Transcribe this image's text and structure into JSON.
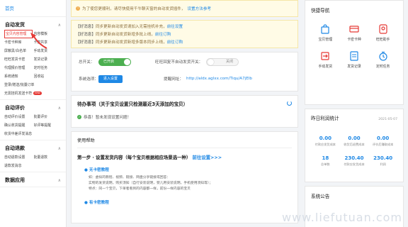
{
  "sidebar": {
    "home": "首页",
    "groups": [
      {
        "title": "自动发货",
        "items": [
          {
            "label": "宝贝内容管理",
            "active": true
          },
          {
            "label": "内容模板"
          },
          {
            "label": "卡密卡种库"
          },
          {
            "label": "卡密共享"
          },
          {
            "label": "屏蔽黑/白名单"
          },
          {
            "label": "手动发货"
          },
          {
            "label": "旺旺发货卡密"
          },
          {
            "label": "发货记录"
          },
          {
            "label": "代理报价管理"
          },
          {
            "label": "定时任务"
          },
          {
            "label": "系统通知"
          },
          {
            "label": "回收站"
          },
          {
            "label": "登录/赠送/批量订单",
            "full": true
          },
          {
            "label": "无需挂机发送卡符",
            "full": true,
            "badge": "new"
          }
        ]
      },
      {
        "title": "自动评价",
        "items": [
          {
            "label": "自动评价设置"
          },
          {
            "label": "批量评价"
          },
          {
            "label": "确认收货提醒"
          },
          {
            "label": "好评等提醒"
          },
          {
            "label": "收货中差评发消息",
            "full": true
          }
        ]
      },
      {
        "title": "自动退款",
        "items": [
          {
            "label": "自动退款设置"
          },
          {
            "label": "批量退款"
          },
          {
            "label": "退款发消息",
            "full": true
          }
        ]
      },
      {
        "title": "数据应用",
        "items": []
      }
    ]
  },
  "main": {
    "notice1": {
      "text": "为了使您更顺利，请尽快使用千牛聊天窗的自动发货插件，",
      "link": "设置方法参考"
    },
    "notice2": [
      {
        "tag": "【好消息】",
        "text": "同步更新自动发货请加入无需挂机补充，",
        "link": "前往设置"
      },
      {
        "tag": "【好消息】",
        "text": "同步更新自动发货新增多批上线，",
        "link": "前往订购"
      },
      {
        "tag": "【好消息】",
        "text": "同步更新自动发货新增多版本同步上线，",
        "link": "前往订购"
      }
    ],
    "switches": {
      "total_label": "总开关：",
      "total_value": "已开启",
      "retry_label": "旺旺回复不自动发货开关：",
      "retry_value": "关闭",
      "status_label": "系统选项：",
      "status_button": "进入设置",
      "reminder_label": "提醒网址：",
      "reminder_link": "http://aldx.aglxx.com/Tiqu/A7jElb"
    },
    "todo": {
      "title": "待办事项（关于宝贝设置只检测最近3天添加的宝贝）",
      "ok_text": "恭喜！暂未发现设置问题！"
    },
    "help": {
      "title": "使用帮助",
      "step1": "第一步 · 设置发货内容（每个宝贝根据相应场景选一种）",
      "step1_link": "前往设置>>>",
      "sub1": "无卡密教程",
      "desc": [
        "如：虚拟的教程、视频、链接、网盘分享链接或回答：",
        "实物的发货说明，购买须知（自行安装说明，婴儿用安装说明，手机使用须知等）；",
        "特点：同一个宝贝，下单者看到的内容都一样，前份一样内容的宝贝"
      ],
      "sub2": "有卡密教程"
    }
  },
  "right": {
    "nav": {
      "title": "快捷导航",
      "items": [
        {
          "label": "宝贝管理",
          "icon": "shopping-bag-icon"
        },
        {
          "label": "卡密卡种",
          "icon": "card-icon"
        },
        {
          "label": "旺旺助手",
          "icon": "assistant-icon"
        },
        {
          "label": "手动发货",
          "icon": "send-icon"
        },
        {
          "label": "发货记录",
          "icon": "record-icon"
        },
        {
          "label": "定时任务",
          "icon": "timer-icon"
        }
      ]
    },
    "stats": {
      "title": "昨日利润统计",
      "date": "2021-05-07",
      "items": [
        {
          "value": "0.00",
          "label": "付款应发货成本"
        },
        {
          "value": "0.00",
          "label": "收货后退费成本"
        },
        {
          "value": "0.00",
          "label": "评价后赚取成本"
        },
        {
          "value": "18",
          "label": "总单数"
        },
        {
          "value": "230.40",
          "label": "付款应发货成本"
        },
        {
          "value": "230.40",
          "label": "利润"
        }
      ]
    },
    "announce": {
      "title": "系统公告"
    }
  },
  "watermark": "www.liefutuan.com",
  "colors": {
    "accent": "#1e88e5",
    "success": "#4caf50",
    "danger": "#e53935"
  }
}
